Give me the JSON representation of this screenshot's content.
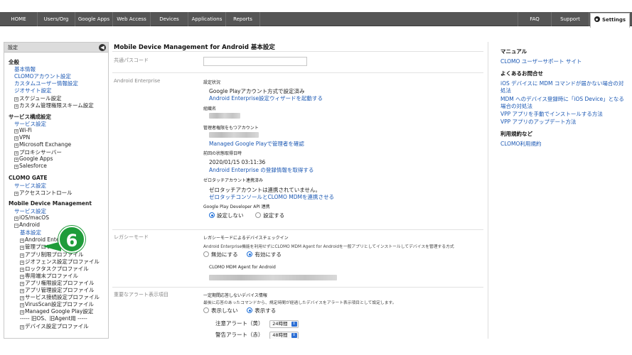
{
  "nav": {
    "tabs": [
      "HOME",
      "Users/Org",
      "Google Apps",
      "Web Access",
      "Devices",
      "Applications",
      "Reports"
    ],
    "right_tabs": [
      "FAQ",
      "Support"
    ],
    "settings_label": "Settings"
  },
  "sidebar": {
    "header": "設定",
    "collapse_glyph": "◀",
    "lines": [
      {
        "t": "全般",
        "k": "h"
      },
      {
        "t": "基本情報",
        "k": "link",
        "i": 1
      },
      {
        "t": "CLOMOアカウント設定",
        "k": "link",
        "i": 1
      },
      {
        "t": "カスタムユーザー情報設定",
        "k": "link",
        "i": 1
      },
      {
        "t": "ジオサイト設定",
        "k": "link",
        "i": 1
      },
      {
        "t": "スケジュール設定",
        "k": "item",
        "i": 1,
        "pm": "⊞"
      },
      {
        "t": "カスタム管理権限スキーム設定",
        "k": "item",
        "i": 1,
        "pm": "⊞"
      },
      {
        "t": "",
        "k": "gap"
      },
      {
        "t": "サービス構成設定",
        "k": "h"
      },
      {
        "t": "サービス設定",
        "k": "link",
        "i": 1
      },
      {
        "t": "Wi-Fi",
        "k": "item",
        "i": 1,
        "pm": "⊞"
      },
      {
        "t": "VPN",
        "k": "item",
        "i": 1,
        "pm": "⊞"
      },
      {
        "t": "Microsoft Exchange",
        "k": "item",
        "i": 1,
        "pm": "⊞"
      },
      {
        "t": "プロキシサーバー",
        "k": "item",
        "i": 1,
        "pm": "⊞"
      },
      {
        "t": "Google Apps",
        "k": "item",
        "i": 1,
        "pm": "⊞"
      },
      {
        "t": "Salesforce",
        "k": "item",
        "i": 1,
        "pm": "⊞"
      },
      {
        "t": "",
        "k": "gap"
      },
      {
        "t": "CLOMO GATE",
        "k": "h"
      },
      {
        "t": "サービス設定",
        "k": "link",
        "i": 1
      },
      {
        "t": "アクセスコントロール",
        "k": "item",
        "i": 1,
        "pm": "⊞"
      },
      {
        "t": "",
        "k": "gap"
      },
      {
        "t": "Mobile Device Management",
        "k": "h"
      },
      {
        "t": "サービス設定",
        "k": "link",
        "i": 1
      },
      {
        "t": "iOS/macOS",
        "k": "item",
        "i": 1,
        "pm": "⊞"
      },
      {
        "t": "Android",
        "k": "item",
        "i": 1,
        "pm": "⊟"
      },
      {
        "t": "基本設定",
        "k": "sel",
        "i": 2
      },
      {
        "t": "Android Enterprise設定",
        "k": "item",
        "i": 2,
        "pm": "⊞"
      },
      {
        "t": "管理プロファイル",
        "k": "item",
        "i": 2,
        "pm": "⊞"
      },
      {
        "t": "アプリ制限プロファイル",
        "k": "item",
        "i": 2,
        "pm": "⊞"
      },
      {
        "t": "ジオフェンス設定プロファイル",
        "k": "item",
        "i": 2,
        "pm": "⊞"
      },
      {
        "t": "ロックタスクプロファイル",
        "k": "item",
        "i": 2,
        "pm": "⊞"
      },
      {
        "t": "専用端末プロファイル",
        "k": "item",
        "i": 2,
        "pm": "⊞"
      },
      {
        "t": "アプリ権限設定プロファイル",
        "k": "item",
        "i": 2,
        "pm": "⊞"
      },
      {
        "t": "アプリ管理設定プロファイル",
        "k": "item",
        "i": 2,
        "pm": "⊞"
      },
      {
        "t": "サービス接続設定プロファイル",
        "k": "item",
        "i": 2,
        "pm": "⊞"
      },
      {
        "t": "VirusScan設定プロファイル",
        "k": "item",
        "i": 2,
        "pm": "⊞"
      },
      {
        "t": "Managed Google Play設定",
        "k": "item",
        "i": 2,
        "pm": "⊞"
      },
      {
        "t": "----- 旧OS、旧Agent用 -----",
        "k": "item",
        "i": 2
      },
      {
        "t": "デバイス設定プロファイル",
        "k": "item",
        "i": 2,
        "pm": "⊞"
      }
    ]
  },
  "step_badge": "6",
  "main": {
    "title": "Mobile Device Management for Android 基本設定",
    "passcode_label": "共通パスコード",
    "ae": {
      "label": "Android Enterprise",
      "status_label": "設定状況",
      "status_value": "Google Playアカウント方式で設定済み",
      "wizard_link": "Android Enterprise設定ウィザードを起動する",
      "org_label": "組織名",
      "admin_label": "管理者権限をもつアカウント",
      "admin_link": "Managed Google Playで管理者を確認",
      "last_label": "前回の状態取得日時",
      "last_value": "2020/01/15 03:11:36",
      "fetch_link": "Android Enterprise の登録情報を取得する",
      "zt_label": "ゼロタッチアカウント連携済み",
      "zt_value": "ゼロタッチアカウントは連携されていません。",
      "zt_link": "ゼロタッチコンソールとCLOMO MDMを連携させる",
      "api_label": "Google Play Developer API 連携",
      "api_off": "設定しない",
      "api_on": "設定する"
    },
    "legacy": {
      "label": "レガシーモード",
      "heading": "レガシーモードによるデバイスチェックイン",
      "desc": "Android Enterprise機能を利用せずにCLOMO MDM Agent for Androidを一般アプリとしてインストールしてデバイスを管理する方式",
      "disable": "無効にする",
      "enable": "有効にする",
      "agent_label": "CLOMO MDM Agent for Android"
    },
    "alert": {
      "label": "重要なアラート表示項目",
      "heading": "一定期間応答しないデバイス情報",
      "desc": "最後に応答のあったコマンドから、規定時間が経過したデバイスをアラート表示項目として設定します。",
      "hide": "表示しない",
      "show": "表示する",
      "caution_label": "注意アラート（黄）",
      "caution_value": "24時間",
      "warning_label": "警告アラート（赤）",
      "warning_value": "48時間"
    }
  },
  "right": {
    "manual_heading": "マニュアル",
    "manual_link": "CLOMO ユーザーサポート サイト",
    "faq_heading": "よくあるお問合せ",
    "faq_links": [
      "iOS デバイスに MDM コマンドが届かない場合の対",
      "処法",
      "MDM へのデバイス登録時に「iOS Device」となる",
      "場合の対処法",
      "VPP アプリを手動でインストールする方法",
      "VPP アプリのアップデート方法"
    ],
    "terms_heading": "利用規約など",
    "terms_link": "CLOMO利用規約"
  }
}
